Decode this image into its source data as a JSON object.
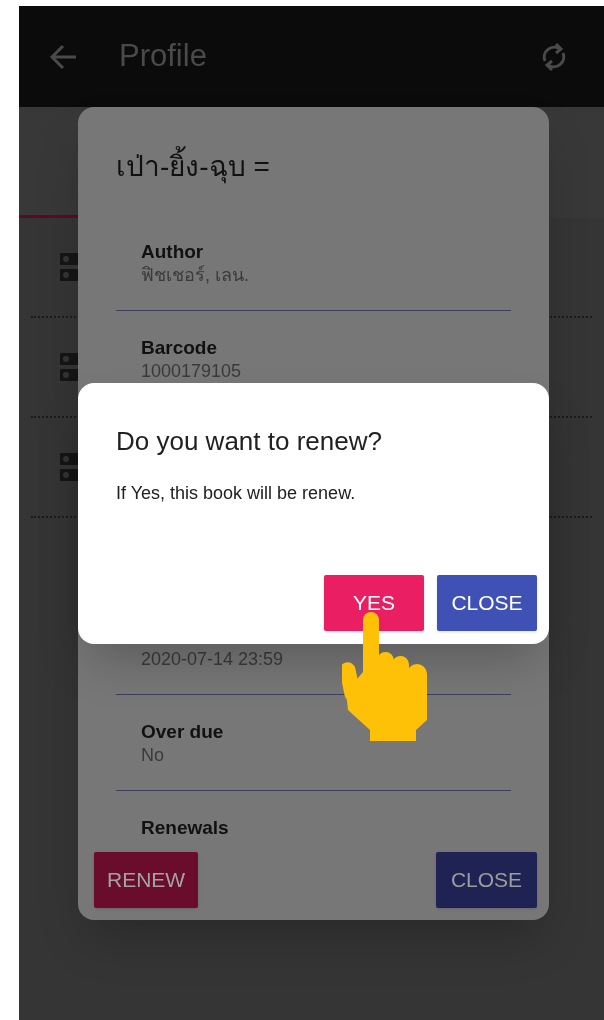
{
  "header": {
    "title": "Profile"
  },
  "list_rows": [
    {
      "kind": "item"
    },
    {
      "kind": "item"
    },
    {
      "kind": "item"
    }
  ],
  "detail_dialog": {
    "title": "เป่า-ยิ้ง-ฉุบ =",
    "fields": [
      {
        "label": "Author",
        "value": "ฟิชเชอร์, เลน."
      },
      {
        "label": "Barcode",
        "value": "1000179105"
      },
      {
        "kind": "gap"
      },
      {
        "value": "2020-07-14 23:59"
      },
      {
        "label": "Over due",
        "value": "No"
      },
      {
        "label": "Renewals"
      }
    ],
    "buttons": [
      {
        "label": "RENEW",
        "kind": "renew"
      },
      {
        "label": "CLOSE",
        "kind": "close"
      }
    ]
  },
  "confirm_dialog": {
    "title": "Do you want to renew?",
    "message": "If Yes, this book will be renew.",
    "buttons": [
      {
        "label": "YES",
        "kind": "confirm"
      },
      {
        "label": "CLOSE",
        "kind": "cancel"
      }
    ]
  }
}
